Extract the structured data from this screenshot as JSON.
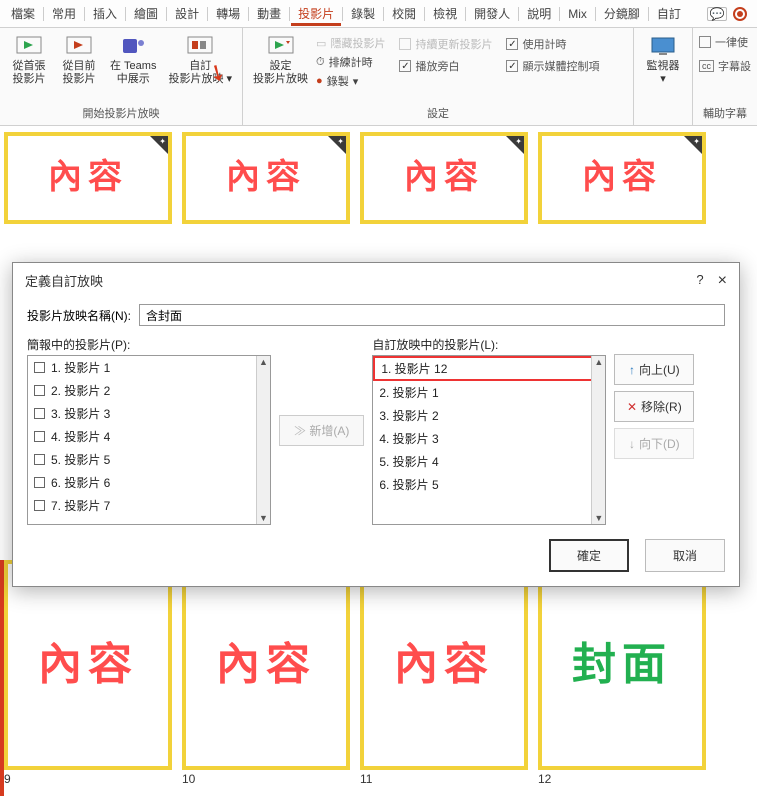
{
  "menu": [
    "檔案",
    "常用",
    "插入",
    "繪圖",
    "設計",
    "轉場",
    "動畫",
    "投影片",
    "錄製",
    "校閱",
    "檢視",
    "開發人",
    "說明",
    "Mix",
    "分鏡腳",
    "自訂"
  ],
  "menu_active_index": 7,
  "ribbon": {
    "group1": {
      "label": "開始投影片放映",
      "btns": [
        {
          "l1": "從首張",
          "l2": "投影片"
        },
        {
          "l1": "從目前",
          "l2": "投影片"
        },
        {
          "l1": "在 Teams",
          "l2": "中展示"
        },
        {
          "l1": "自訂",
          "l2": "投影片放映"
        }
      ]
    },
    "group2": {
      "label": "設定",
      "btn": {
        "l1": "設定",
        "l2": "投影片放映"
      },
      "lines": [
        {
          "icon": "hidden",
          "text": "隱藏投影片",
          "disabled": true
        },
        {
          "icon": "timer",
          "text": "排練計時"
        },
        {
          "icon": "rec",
          "text": "錄製",
          "caret": true
        }
      ],
      "checks": [
        {
          "label": "持續更新投影片",
          "checked": false,
          "disabled": true
        },
        {
          "label": "播放旁白",
          "checked": true
        },
        {
          "label": "使用計時",
          "checked": true
        },
        {
          "label": "顯示媒體控制項",
          "checked": true
        }
      ]
    },
    "group3": {
      "label": "",
      "btn": {
        "l1": "監視器",
        "l2": ""
      }
    },
    "group4": {
      "label": "輔助字幕",
      "checks": [
        {
          "label": "一律使",
          "checked": false
        },
        {
          "label": "字幕設",
          "icon": "cc"
        }
      ]
    }
  },
  "thumbs_top": [
    {
      "text": "內容"
    },
    {
      "text": "內容"
    },
    {
      "text": "內容"
    },
    {
      "text": "內容"
    }
  ],
  "thumbs_bottom": [
    {
      "text": "內容",
      "num": "9"
    },
    {
      "text": "內容",
      "num": "10"
    },
    {
      "text": "內容",
      "num": "11"
    },
    {
      "text": "封面",
      "num": "12",
      "green": true
    }
  ],
  "dialog": {
    "title": "定義自訂放映",
    "help": "?",
    "close": "×",
    "name_label": "投影片放映名稱(N):",
    "name_value": "含封面",
    "left_label": "簡報中的投影片(P):",
    "left_items": [
      "1. 投影片 1",
      "2. 投影片 2",
      "3. 投影片 3",
      "4. 投影片 4",
      "5. 投影片 5",
      "6. 投影片 6",
      "7. 投影片 7"
    ],
    "add_btn": "新增(A)",
    "right_label": "自訂放映中的投影片(L):",
    "right_items": [
      "1. 投影片 12",
      "2. 投影片 1",
      "3. 投影片 2",
      "4. 投影片 3",
      "5. 投影片 4",
      "6. 投影片 5"
    ],
    "up_btn": "向上(U)",
    "remove_btn": "移除(R)",
    "down_btn": "向下(D)",
    "ok": "確定",
    "cancel": "取消"
  }
}
